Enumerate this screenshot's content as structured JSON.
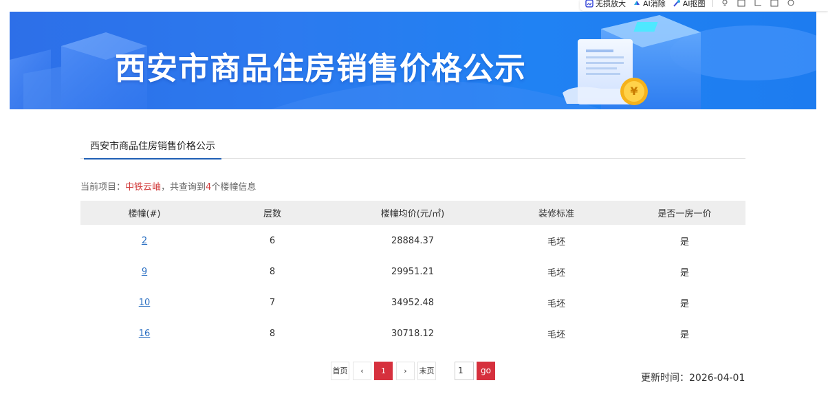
{
  "toolbar": {
    "items": [
      {
        "label": "无损放大",
        "icon": "image-enlarge-icon"
      },
      {
        "label": "AI消除",
        "icon": "ai-erase-icon"
      },
      {
        "label": "AI抠图",
        "icon": "ai-cutout-icon"
      }
    ]
  },
  "banner": {
    "title": "西安市商品住房销售价格公示"
  },
  "tab": {
    "label": "西安市商品住房销售价格公示"
  },
  "info": {
    "prefix": "当前项目：",
    "project": "中铁云岫",
    "middle": "，共查询到",
    "count": "4",
    "suffix": "个楼幢信息"
  },
  "table": {
    "headers": [
      "楼幢(#)",
      "层数",
      "楼幢均价(元/㎡)",
      "装修标准",
      "是否一房一价"
    ],
    "rows": [
      {
        "building": "2",
        "floors": "6",
        "avg_price": "28884.37",
        "decoration": "毛坯",
        "one_price": "是"
      },
      {
        "building": "9",
        "floors": "8",
        "avg_price": "29951.21",
        "decoration": "毛坯",
        "one_price": "是"
      },
      {
        "building": "10",
        "floors": "7",
        "avg_price": "34952.48",
        "decoration": "毛坯",
        "one_price": "是"
      },
      {
        "building": "16",
        "floors": "8",
        "avg_price": "30718.12",
        "decoration": "毛坯",
        "one_price": "是"
      }
    ]
  },
  "pagination": {
    "first": "首页",
    "prev": "‹",
    "current": "1",
    "next": "›",
    "last": "末页",
    "input_value": "1",
    "go": "go"
  },
  "updated": {
    "label": "更新时间：",
    "date": "2026-04-01"
  },
  "colors": {
    "accent_red": "#d6303d",
    "link_blue": "#2a6fc2",
    "tab_underline": "#1e5eb5",
    "banner_blue": "#2d7cf0"
  }
}
